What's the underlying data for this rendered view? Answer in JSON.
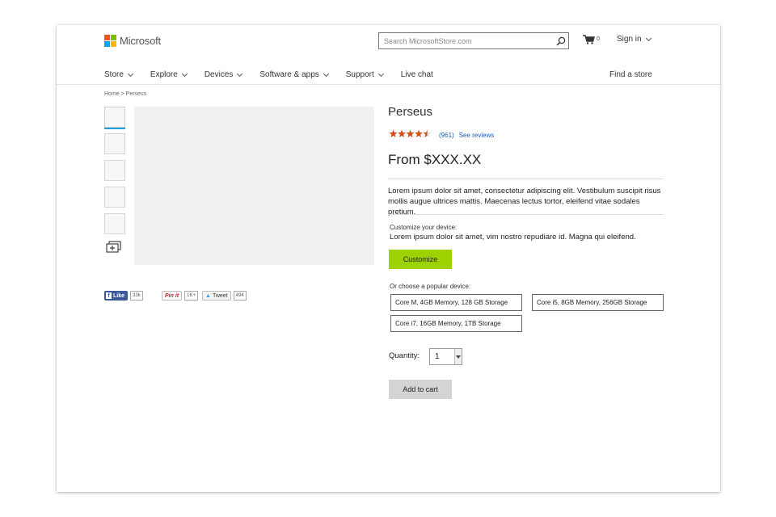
{
  "colors": {
    "accent_green": "#9ed100",
    "link_blue": "#1a5fb0",
    "star_orange": "#d44d16",
    "thumb_indicator": "#1fa1d6",
    "logo": [
      "#f35325",
      "#81bc06",
      "#05a6f0",
      "#ffba08"
    ]
  },
  "header": {
    "brand": "Microsoft",
    "search": {
      "placeholder": "Search MicrosoftStore.com",
      "value": "",
      "icon": "search-icon"
    },
    "cart": {
      "icon": "cart-icon",
      "count": "0"
    },
    "sign_in": "Sign in"
  },
  "nav": {
    "items": [
      {
        "label": "Store",
        "dropdown": true
      },
      {
        "label": "Explore",
        "dropdown": true
      },
      {
        "label": "Devices",
        "dropdown": true
      },
      {
        "label": "Software & apps",
        "dropdown": true
      },
      {
        "label": "Support",
        "dropdown": true
      },
      {
        "label": "Live chat",
        "dropdown": false
      }
    ],
    "find_store": "Find a store"
  },
  "breadcrumb": "Home > Perseus",
  "gallery": {
    "thumbnail_count": 5,
    "active_index": 0,
    "more_icon": "gallery-icon"
  },
  "social": {
    "facebook_label": "Like",
    "facebook_count": "33k",
    "pinterest_label": "Pin it",
    "pinterest_count": "1K+",
    "twitter_label": "Tweet",
    "twitter_count": "494"
  },
  "product": {
    "title": "Perseus",
    "rating": {
      "stars": 4.5,
      "max": 5,
      "count": "(961)",
      "see_reviews": "See reviews"
    },
    "price": "From $XXX.XX",
    "description": "Lorem ipsum dolor sit amet, consectetur adipiscing elit. Vestibulum suscipit risus mollis augue ultrices mattis. Maecenas lectus tortor, eleifend vitae sodales pretium.",
    "customize": {
      "label": "Customize your device:",
      "text": "Lorem ipsum dolor sit amet, vim nostro repudiare id. Magna qui eleifend.",
      "button": "Customize"
    },
    "popular": {
      "label": "Or choose a popular device:",
      "options": [
        "Core M, 4GB Memory, 128 GB Storage",
        "Core i5, 8GB Memory, 256GB Storage",
        "Core i7, 16GB Memory, 1TB Storage"
      ]
    },
    "quantity": {
      "label": "Quantity:",
      "value": "1"
    },
    "add_to_cart": "Add to cart"
  }
}
